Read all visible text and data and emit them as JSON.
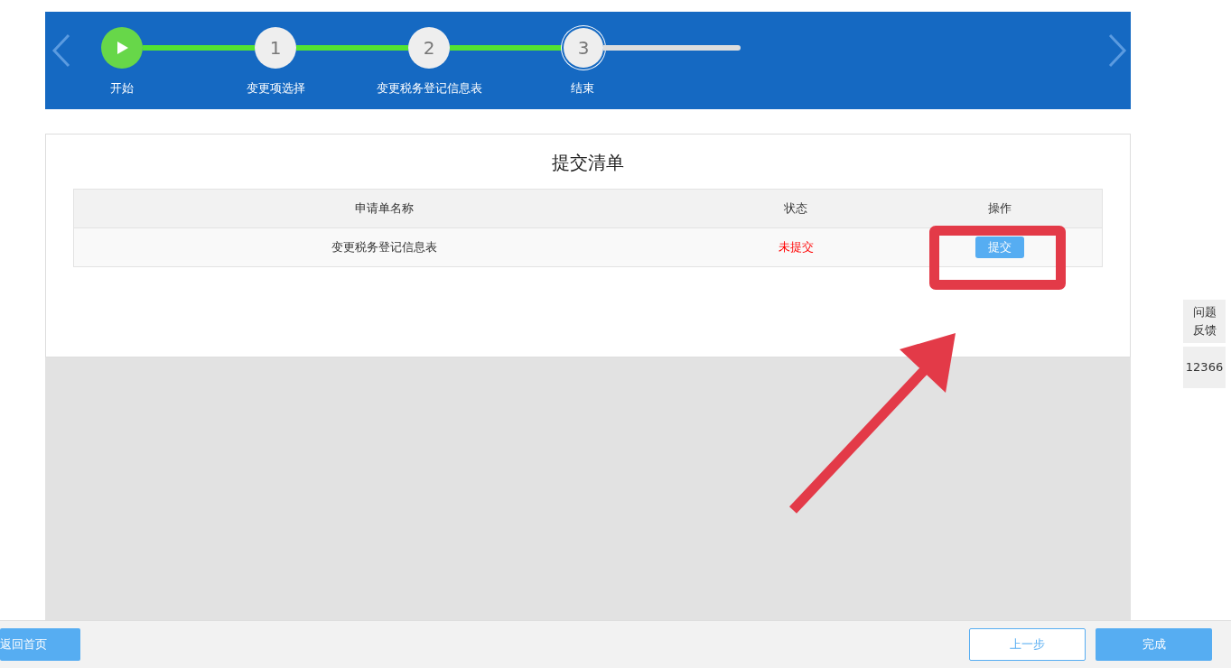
{
  "steps": [
    {
      "kind": "start",
      "label": "开始",
      "reached": true,
      "current": false
    },
    {
      "kind": "number",
      "number": "1",
      "label": "变更项选择",
      "reached": true,
      "current": false
    },
    {
      "kind": "number",
      "number": "2",
      "label": "变更税务登记信息表",
      "reached": true,
      "current": false
    },
    {
      "kind": "number",
      "number": "3",
      "label": "结束",
      "reached": true,
      "current": true
    }
  ],
  "panel": {
    "title": "提交清单",
    "table": {
      "columns": [
        "申请单名称",
        "状态",
        "操作"
      ],
      "rows": [
        {
          "name": "变更税务登记信息表",
          "status": "未提交",
          "action": "提交"
        }
      ]
    }
  },
  "side_widget": {
    "feedback": "问题反馈",
    "hotline": "12366"
  },
  "footer": {
    "home_button": "返回首页",
    "prev_button": "上一步",
    "finish_button": "完成"
  }
}
